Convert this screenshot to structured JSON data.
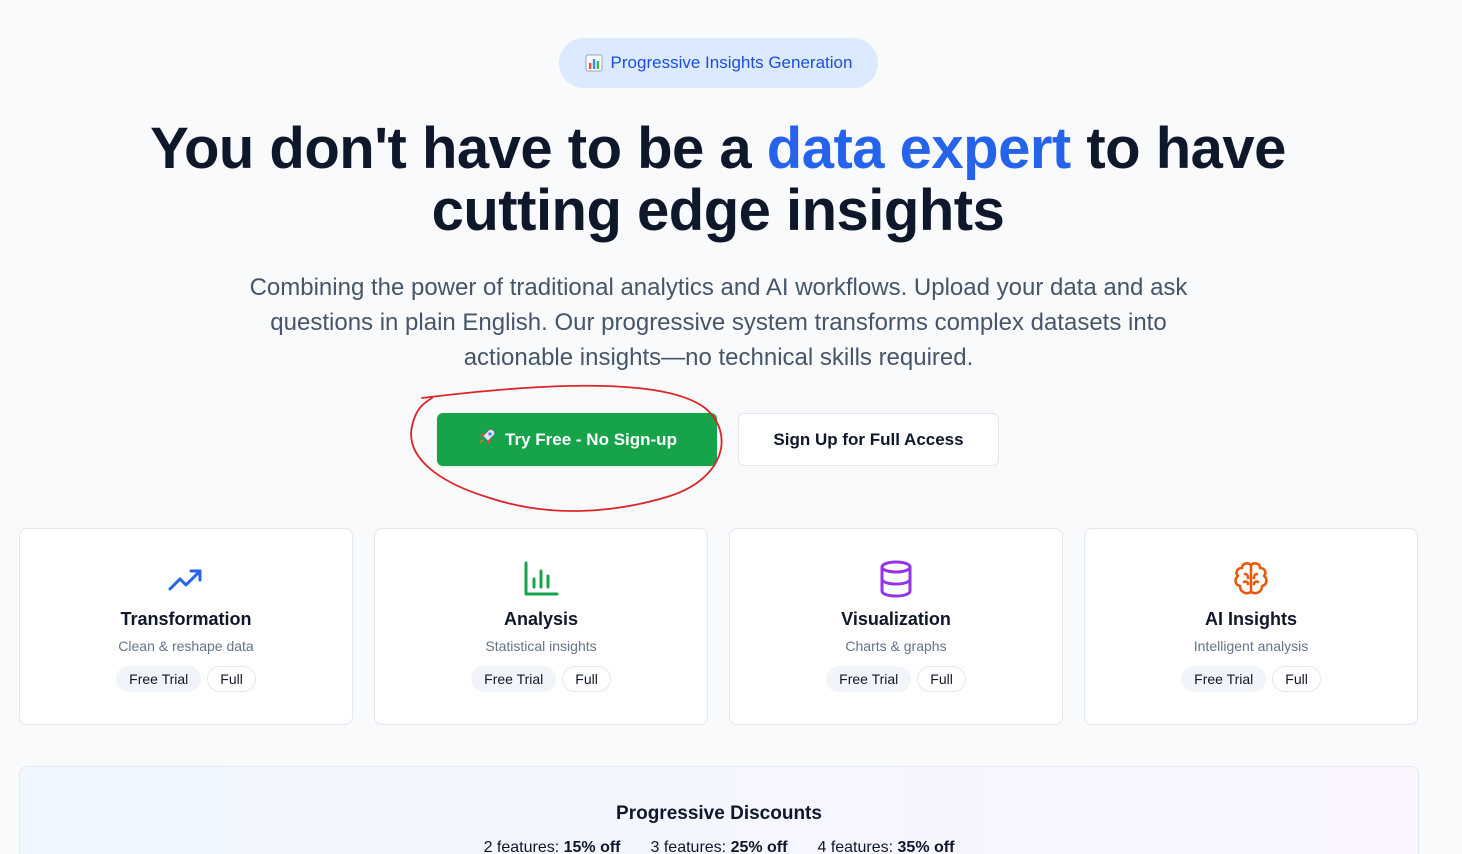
{
  "badge": {
    "icon": "bar-chart-emoji-icon",
    "label": "Progressive Insights Generation"
  },
  "hero": {
    "title_part1": "You don't have to be a ",
    "title_accent": "data expert",
    "title_part2": " to have cutting edge insights",
    "subtitle": "Combining the power of traditional analytics and AI workflows. Upload your data and ask questions in plain English. Our progressive system transforms complex datasets into actionable insights—no technical skills required."
  },
  "cta": {
    "primary_icon": "rocket-icon",
    "primary_label": "Try Free - No Sign-up",
    "secondary_label": "Sign Up for Full Access"
  },
  "features": [
    {
      "icon": "trending-up-icon",
      "color": "#2563eb",
      "title": "Transformation",
      "desc": "Clean & reshape data",
      "tag_trial": "Free Trial",
      "tag_full": "Full"
    },
    {
      "icon": "bar-chart-icon",
      "color": "#16a34a",
      "title": "Analysis",
      "desc": "Statistical insights",
      "tag_trial": "Free Trial",
      "tag_full": "Full"
    },
    {
      "icon": "database-icon",
      "color": "#9333ea",
      "title": "Visualization",
      "desc": "Charts & graphs",
      "tag_trial": "Free Trial",
      "tag_full": "Full"
    },
    {
      "icon": "brain-icon",
      "color": "#ea580c",
      "title": "AI Insights",
      "desc": "Intelligent analysis",
      "tag_trial": "Free Trial",
      "tag_full": "Full"
    }
  ],
  "discounts": {
    "title": "Progressive Discounts",
    "items": [
      {
        "label": "2 features: ",
        "value": "15% off"
      },
      {
        "label": "3 features: ",
        "value": "25% off"
      },
      {
        "label": "4 features: ",
        "value": "35% off"
      }
    ]
  },
  "annotation": {
    "color": "#dc2626"
  }
}
